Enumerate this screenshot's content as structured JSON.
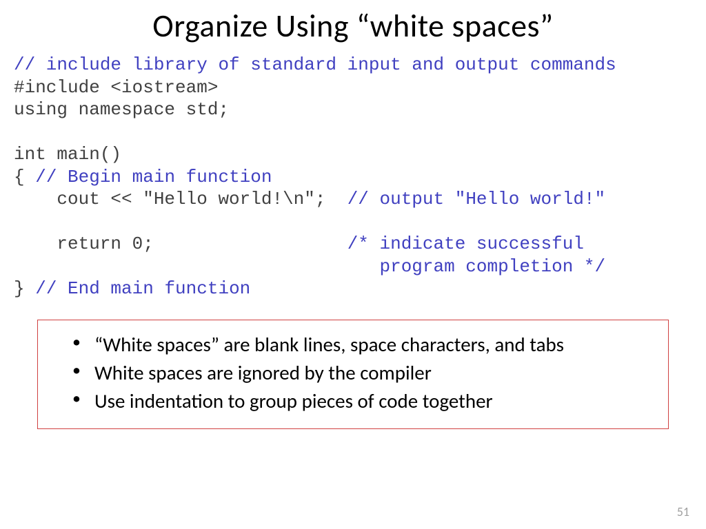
{
  "title": "Organize Using “white spaces”",
  "code": {
    "l1_comment": "// include library of standard input and output commands",
    "l2_code": "#include <iostream>",
    "l3_code": "using namespace std;",
    "l4_blank": "",
    "l5_code": "int main()",
    "l6_brace": "{ ",
    "l6_comment": "// Begin main function",
    "l7_code": "    cout << \"Hello world!\\n\";  ",
    "l7_comment": "// output \"Hello world!\"",
    "l8_blank": "",
    "l9_code": "    return 0;                  ",
    "l9_comment": "/* indicate successful",
    "l10_comment": "                                  program completion */",
    "l11_brace": "} ",
    "l11_comment": "// End main function"
  },
  "bullets": {
    "b1": "“White spaces” are blank lines, space characters, and tabs",
    "b2": "White spaces are ignored by the compiler",
    "b3": "Use indentation to group pieces of code together"
  },
  "page_number": "51"
}
